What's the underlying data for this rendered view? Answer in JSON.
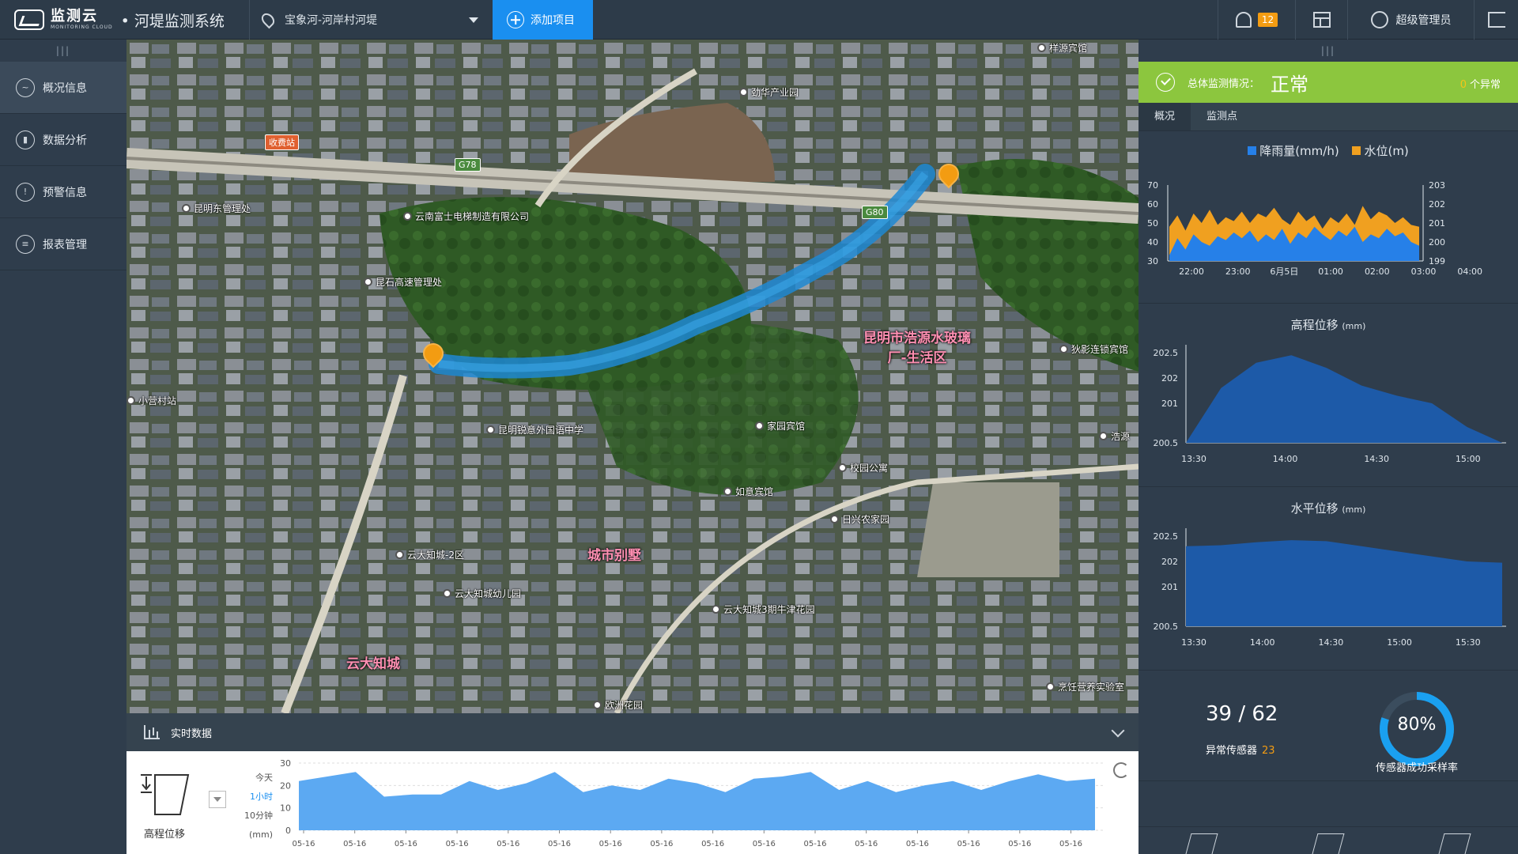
{
  "topbar": {
    "logo_cn": "监测云",
    "logo_en": "MONITORING CLOUD",
    "system_title": "• 河堤监测系统",
    "project": "宝象河-河岸村河堤",
    "add_project": "添加项目",
    "notification_count": "12",
    "user": "超级管理员"
  },
  "sidebar": {
    "items": [
      {
        "label": "概况信息",
        "icon": "overview-icon"
      },
      {
        "label": "数据分析",
        "icon": "analysis-icon"
      },
      {
        "label": "预警信息",
        "icon": "warning-icon"
      },
      {
        "label": "报表管理",
        "icon": "report-icon"
      }
    ]
  },
  "map": {
    "pois": [
      "昆明东管理处",
      "云南富士电梯制造有限公司",
      "昆石高速管理处",
      "劲华产业园",
      "样源宾馆",
      "小营村站",
      "昆明锐意外国语中学",
      "家园宾馆",
      "校园公寓",
      "如意宾馆",
      "日兴农家园",
      "云大知城-2区",
      "云大知城幼儿园",
      "云大知城3期牛津花园",
      "欧洲花园",
      "狄影连锁宾馆",
      "浩源",
      "烹饪营养实验室"
    ],
    "areas": [
      "昆明市浩源水玻璃厂-生活区",
      "城市别墅",
      "云大知城"
    ],
    "roads": [
      "G78",
      "G80"
    ],
    "toll": "收费站"
  },
  "status": {
    "label": "总体监测情况：",
    "value": "正常",
    "abnormal_count": "0",
    "abnormal_label": "个异常"
  },
  "tabs": [
    "概况",
    "监测点"
  ],
  "rain_chart": {
    "legend_rain": "降雨量(mm/h)",
    "legend_level": "水位(m)",
    "left_ticks": [
      "70",
      "60",
      "50",
      "40",
      "30"
    ],
    "right_ticks": [
      "203",
      "202",
      "201",
      "200",
      "199"
    ],
    "x_ticks": [
      "22:00",
      "23:00",
      "6月5日",
      "01:00",
      "02:00",
      "03:00",
      "04:00"
    ]
  },
  "elev_chart": {
    "title": "高程位移",
    "unit": "(mm)",
    "y_ticks": [
      "202.5",
      "202",
      "201",
      "200.5"
    ],
    "x_ticks": [
      "13:30",
      "14:00",
      "14:30",
      "15:00"
    ]
  },
  "horiz_chart": {
    "title": "水平位移",
    "unit": "(mm)",
    "y_ticks": [
      "202.5",
      "202",
      "201",
      "200.5"
    ],
    "x_ticks": [
      "13:30",
      "14:00",
      "14:30",
      "15:00",
      "15:30"
    ]
  },
  "stats": {
    "count": "39 / 62",
    "abnormal_label": "异常传感器",
    "abnormal_value": "23",
    "rate": "80%",
    "rate_label": "传感器成功采样率",
    "rate_fraction": 0.8
  },
  "realtime": {
    "title": "实时数据",
    "sensor_label": "高程位移",
    "ranges": [
      "今天",
      "1小时",
      "10分钟",
      "(mm)"
    ],
    "y_ticks": [
      "30",
      "20",
      "10",
      "0"
    ],
    "x_label": "05-16"
  },
  "colors": {
    "accent": "#1a8ff0",
    "status_green": "#8cc63e",
    "rain_blue": "#2680e8",
    "level_orange": "#f0a020"
  },
  "chart_data": [
    {
      "type": "area",
      "legend": [
        "降雨量(mm/h)",
        "水位(m)"
      ],
      "x": [
        "22:00",
        "23:00",
        "6月5日",
        "01:00",
        "02:00",
        "03:00",
        "04:00"
      ],
      "series": [
        {
          "name": "降雨量(mm/h)",
          "values": [
            33,
            42,
            36,
            44,
            40,
            38,
            43,
            41,
            45,
            42,
            46,
            40,
            44,
            41,
            47,
            39,
            45,
            42,
            48,
            44,
            41,
            46,
            43,
            48,
            40,
            44,
            42,
            47,
            43,
            45,
            40,
            38
          ]
        },
        {
          "name": "水位(m)",
          "values": [
            48,
            54,
            46,
            55,
            50,
            57,
            49,
            53,
            51,
            56,
            50,
            55,
            53,
            58,
            52,
            49,
            56,
            51,
            54,
            47,
            53,
            50,
            55,
            49,
            59,
            52,
            56,
            54,
            50,
            53,
            49,
            48
          ]
        }
      ],
      "ylim": [
        30,
        70
      ],
      "y2lim": [
        199,
        203
      ]
    },
    {
      "type": "area",
      "title": "高程位移",
      "x": [
        "13:30",
        "14:00",
        "14:30",
        "15:00"
      ],
      "values": [
        200.5,
        201.6,
        202.3,
        202.45,
        202.2,
        201.7,
        201.3,
        201.0,
        200.7,
        200.5
      ],
      "ylim": [
        200.5,
        202.5
      ]
    },
    {
      "type": "area",
      "title": "水平位移",
      "x": [
        "13:30",
        "14:00",
        "14:30",
        "15:00",
        "15:30"
      ],
      "values": [
        202.3,
        202.32,
        202.38,
        202.42,
        202.4,
        202.3,
        202.2,
        202.1,
        202.0,
        201.95
      ],
      "ylim": [
        200.5,
        202.5
      ]
    },
    {
      "type": "area",
      "title": "高程位移",
      "x": [
        "05-16",
        "05-16",
        "05-16",
        "05-16",
        "05-16",
        "05-16",
        "05-16",
        "05-16",
        "05-16",
        "05-16",
        "05-16",
        "05-16",
        "05-16",
        "05-16",
        "05-16",
        "05-16"
      ],
      "values": [
        22,
        24,
        26,
        15,
        16,
        16,
        22,
        18,
        21,
        26,
        17,
        20,
        18,
        23,
        21,
        17,
        23,
        24,
        26,
        18,
        22,
        17,
        20,
        22,
        18,
        22,
        25,
        22,
        23
      ],
      "ylim": [
        0,
        30
      ]
    }
  ]
}
